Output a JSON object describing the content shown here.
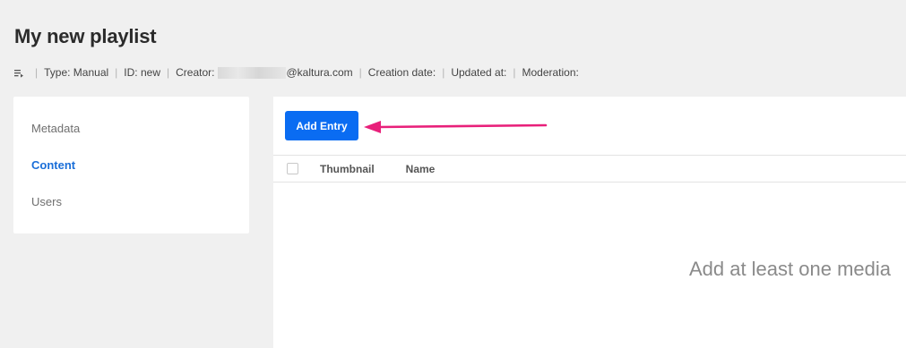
{
  "header": {
    "title": "My new playlist",
    "meta": {
      "icon": "playlist-icon",
      "type": "Type: Manual",
      "id": "ID: new",
      "creator_label": "Creator:",
      "creator_domain": "@kaltura.com",
      "creation_date": "Creation date:",
      "updated_at": "Updated at:",
      "moderation": "Moderation:"
    }
  },
  "sidebar": {
    "items": [
      {
        "label": "Metadata",
        "active": false
      },
      {
        "label": "Content",
        "active": true
      },
      {
        "label": "Users",
        "active": false
      }
    ]
  },
  "content": {
    "add_entry_label": "Add Entry",
    "columns": [
      "Thumbnail",
      "Name"
    ],
    "empty_message": "Add at least one media"
  },
  "colors": {
    "accent": "#0a6cf2",
    "active_link": "#1a6ed8",
    "arrow": "#e8207a"
  }
}
